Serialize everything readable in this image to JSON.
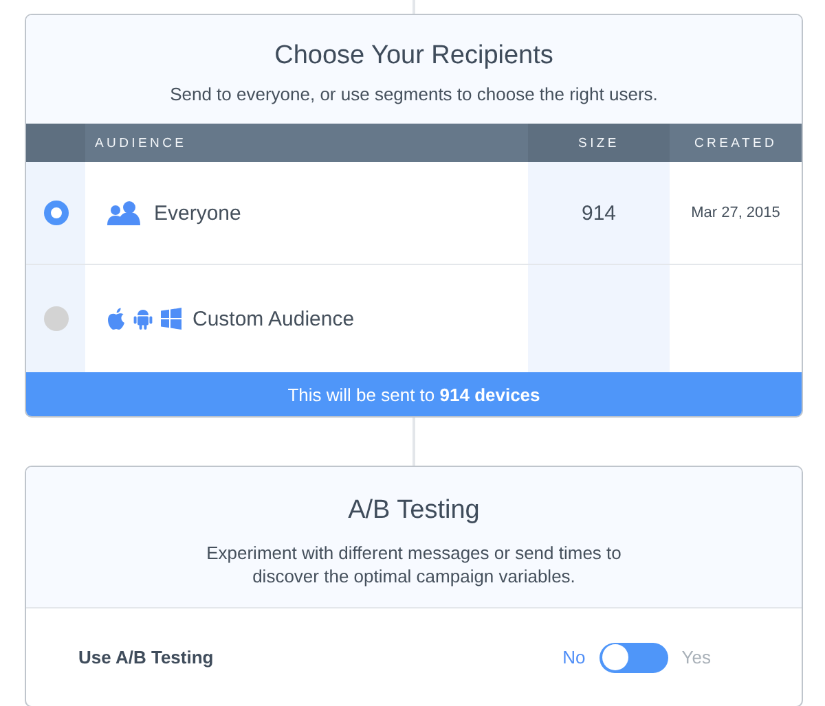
{
  "recipients": {
    "title": "Choose Your Recipients",
    "subtitle": "Send to everyone, or use segments to choose the right users.",
    "columns": [
      "AUDIENCE",
      "SIZE",
      "CREATED"
    ],
    "rows": [
      {
        "selected": true,
        "kind": "everyone",
        "audience": "Everyone",
        "size": "914",
        "created": "Mar 27, 2015"
      },
      {
        "selected": false,
        "kind": "platforms",
        "audience": "Custom Audience"
      }
    ],
    "footer": "This will be sent to **914 devices**"
  },
  "ab_testing": {
    "title": "A/B Testing",
    "subtitle": "Experiment with different messages or send times to discover the optimal campaign variables.",
    "setting": {
      "label": "Use A/B Testing",
      "off_label": "No",
      "on_label": "Yes",
      "on": false
    }
  }
}
